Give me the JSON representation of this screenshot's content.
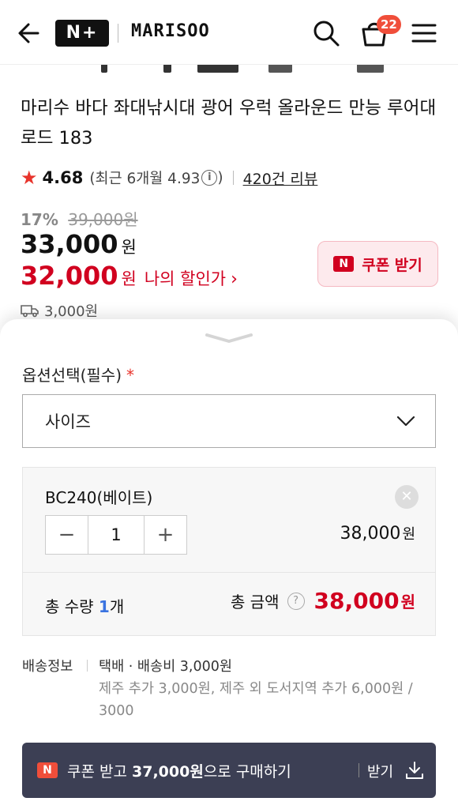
{
  "header": {
    "naver_plus_logo": "N+",
    "brand_logo": "MARISOO",
    "cart_count": "22"
  },
  "product": {
    "title": "마리수 바다 좌대낚시대 광어 우럭 올라운드 만능 루어대 로드 183",
    "rating": "4.68",
    "recent_rating": "(최근 6개월 4.93",
    "recent_rating_close": ")",
    "review_count": "420건 리뷰",
    "discount_rate": "17%",
    "original_price": "39,000원",
    "price": "33,000",
    "price_unit": "원",
    "my_price": "32,000",
    "my_price_unit": "원",
    "my_price_label": "나의 할인가",
    "coupon_button": "쿠폰 받기",
    "shipping_fee": "3,000원"
  },
  "option_sheet": {
    "option_label": "옵션선택(필수)",
    "required_mark": "*",
    "select_value": "사이즈",
    "selected_item": {
      "name": "BC240(베이트)",
      "quantity": "1",
      "price": "38,000",
      "price_unit": "원"
    },
    "total_qty_label": "총 수량",
    "total_qty": "1",
    "total_qty_unit": "개",
    "total_amount_label": "총 금액",
    "total_amount": "38,000",
    "total_amount_unit": "원"
  },
  "shipping_info": {
    "label": "배송정보",
    "line1": "택배 · 배송비 3,000원",
    "line2": "제주 추가 3,000원, 제주 외 도서지역 추가 6,000원 / 3000"
  },
  "buy_bar": {
    "n_mark": "N",
    "text_prefix": "쿠폰 받고",
    "text_amount": "37,000원",
    "text_suffix": "으로 구매하기",
    "receive_label": "받기"
  },
  "colors": {
    "accent_red": "#d1001f",
    "badge_red": "#f04e3a",
    "qty_blue": "#3a73e0",
    "buy_bar_bg": "#3c3f54"
  },
  "icons": [
    "back-arrow-icon",
    "search-icon",
    "cart-icon",
    "menu-icon",
    "star-icon",
    "info-icon",
    "chevron-right-icon",
    "truck-icon",
    "chevron-down-icon",
    "close-icon",
    "minus-icon",
    "plus-icon",
    "question-icon",
    "download-icon"
  ]
}
